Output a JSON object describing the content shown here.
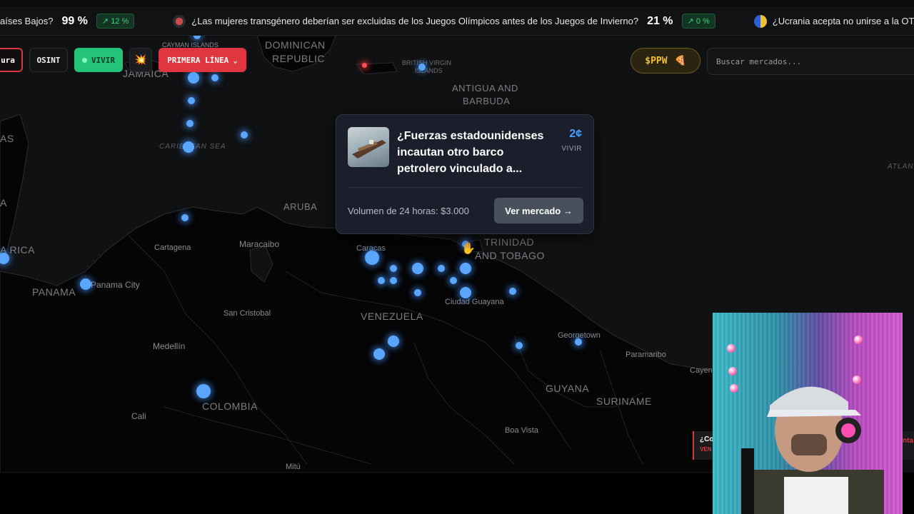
{
  "ticker": [
    {
      "question": "aíses Bajos?",
      "percent": "99 %",
      "change": "12 %",
      "flag_color": "#000000"
    },
    {
      "question": "¿Las mujeres transgénero deberían ser excluidas de los Juegos Olímpicos antes de los Juegos de Invierno?",
      "percent": "21 %",
      "change": "0 %",
      "flag_color": "#b53a3a"
    },
    {
      "question": "¿Ucrania acepta no unirse a la OTAN",
      "percent": "",
      "change": "",
      "flag_color": "#2f5fd0"
    }
  ],
  "toolbar": {
    "cut_label": "ura",
    "osint_label": "OSINT",
    "live_label": "VIVIR",
    "fire_icon": "fire-icon",
    "frontline_label": "PRIMERA LÍNEA",
    "token_label": "$PPW",
    "search_placeholder": "Buscar mercados..."
  },
  "map": {
    "labels": {
      "cayman": "CAYMAN ISLANDS",
      "jamaica": "JAMAICA",
      "dominican": "DOMINICAN",
      "republic": "REPUBLIC",
      "bvi": "BRITISH VIRGIN",
      "islands": "ISLANDS",
      "antigua": "ANTIGUA AND",
      "barbuda": "BARBUDA",
      "caribbean": "CARIBBEAN SEA",
      "as": "AS",
      "a": "A",
      "rica": "A RICA",
      "aruba": "ARUBA",
      "cartagena": "Cartagena",
      "maracaibo": "Maracaibo",
      "caracas": "Caracas",
      "trinidad": "TRINIDAD",
      "tobago": "AND TOBAGO",
      "panama": "PANAMA",
      "panama_city": "Panama City",
      "san_cristobal": "San Cristobal",
      "venezuela": "VENEZUELA",
      "ciudad_guayana": "Ciudad Guayana",
      "medellin": "Medellín",
      "georgetown": "Georgetown",
      "paramaribo": "Paramaribo",
      "cayenne": "Cayenn",
      "guyana": "GUYANA",
      "suriname": "SURINAME",
      "colombia": "COLOMBIA",
      "cali": "Cali",
      "boa_vista": "Boa Vista",
      "mitu": "Mitú",
      "atlantic": "ATLANT"
    }
  },
  "popup": {
    "title": "¿Fuerzas estadounidenses incautan otro barco petrolero vinculado a...",
    "price": "2¢",
    "status": "VIVIR",
    "volume": "Volumen de 24 horas: $3.000",
    "button": "Ver mercado →"
  },
  "cam_overlay": {
    "left_text": "¿Co",
    "left_sub": "VEN",
    "right_text": "nta"
  }
}
